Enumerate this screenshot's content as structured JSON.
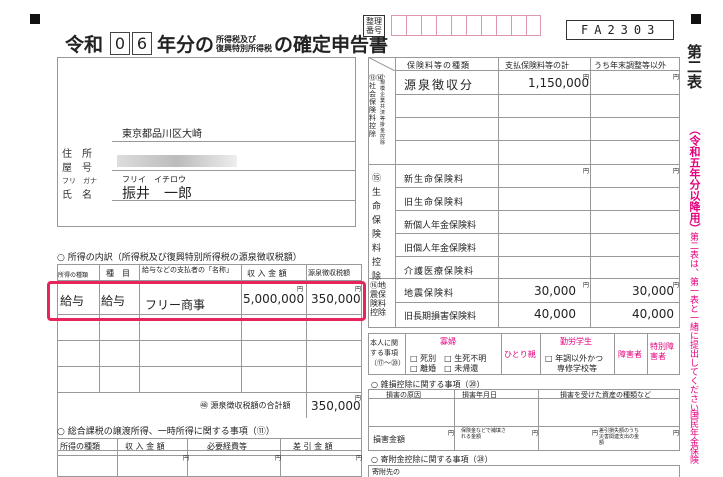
{
  "header": {
    "era": "令和",
    "year_digits": [
      "0",
      "6"
    ],
    "title_part1": "年分の",
    "title_small_top": "所得税及び",
    "title_small_bottom": "復興特別所得税",
    "title_part2": "の確定申告書",
    "seiri_label_top": "整理",
    "seiri_label_bottom": "番号",
    "form_code": "FA2303",
    "side_title": "第二表",
    "side_note": "（令和五年分以降用）",
    "side_note2": "第二表は、第一表と一緒に提出してください。",
    "side_note3": "国民年金保険"
  },
  "identity": {
    "address_label": "住　所",
    "yago_label": "屋　号",
    "address_value": "東京都品川区大崎",
    "furigana_label": "フリ　ガナ",
    "name_label": "氏　名",
    "furigana_value": "フリイ　イチロウ",
    "name_value": "振井　一郎"
  },
  "income_breakdown": {
    "section_title": "所得の内訳（所得税及び復興特別所得税の源泉徴収税額）",
    "col_type": "所得の種類",
    "col_item": "種　目",
    "col_payer": "給与などの支払者の「名称」",
    "col_income": "収 入 金 額",
    "col_withheld": "源泉徴収税額",
    "yen": "円",
    "rows": [
      {
        "type": "給与",
        "item": "給与",
        "payer": "フリー商事",
        "income": "5,000,000",
        "withheld": "350,000"
      }
    ],
    "total_label": "源泉徴収税額の合計額",
    "total_num": "48",
    "total_value": "350,000"
  },
  "transfer_income": {
    "section_title": "総合課税の譲渡所得、一時所得に関する事項（⑪）",
    "col_type": "所得の種類",
    "col_income": "収 入 金 額",
    "col_expense": "必要経費等",
    "col_diff": "差 引 金 額"
  },
  "insurance": {
    "col_kind": "保険料等の種類",
    "col_paid": "支払保険料等の計",
    "col_year_end": "うち年末調整等以外",
    "social_label": "⑬⑭社会保険料控除",
    "social_sub": "小規模企業共済等掛金控除",
    "social_rows": [
      {
        "kind": "源泉徴収分",
        "paid": "1,150,000",
        "year_end": ""
      }
    ],
    "life_label": "⑮生命保険料控除",
    "life_rows": [
      {
        "kind": "新生命保険料"
      },
      {
        "kind": "旧生命保険料"
      },
      {
        "kind": "新個人年金保険料"
      },
      {
        "kind": "旧個人年金保険料"
      },
      {
        "kind": "介護医療保険料"
      }
    ],
    "quake_label": "⑯地震保険料控除",
    "quake_rows": [
      {
        "kind": "地震保険料",
        "paid": "30,000",
        "year_end": "30,000"
      },
      {
        "kind": "旧長期損害保険料",
        "paid": "40,000",
        "year_end": "40,000"
      }
    ],
    "yen": "円"
  },
  "personal": {
    "label": "本人に関する事項（⑰〜⑳）",
    "widow": "寡婦",
    "hitori": "ひとり親",
    "student": "勤労学生",
    "disabled": "障害者",
    "special_disabled": "特別障害者",
    "opt_dead": "死別",
    "opt_divorce": "離婚",
    "opt_unknown": "生死不明",
    "opt_unreturned": "未帰還",
    "opt_other": "年調以外かつ",
    "opt_school": "専修学校等"
  },
  "casualty": {
    "section_title": "雑損控除に関する事項（⑳）",
    "col_cause": "損害の原因",
    "col_date": "損害年月日",
    "col_asset": "損害を受けた資産の種類など",
    "amount_label": "損害金額",
    "insurance_label": "保険金などで補填される金額",
    "deductible_label": "差引損失額のうち災害関連支出の金額"
  },
  "donation": {
    "section_title": "寄附金控除に関する事項（㉘）",
    "payee_label": "寄附先の"
  }
}
